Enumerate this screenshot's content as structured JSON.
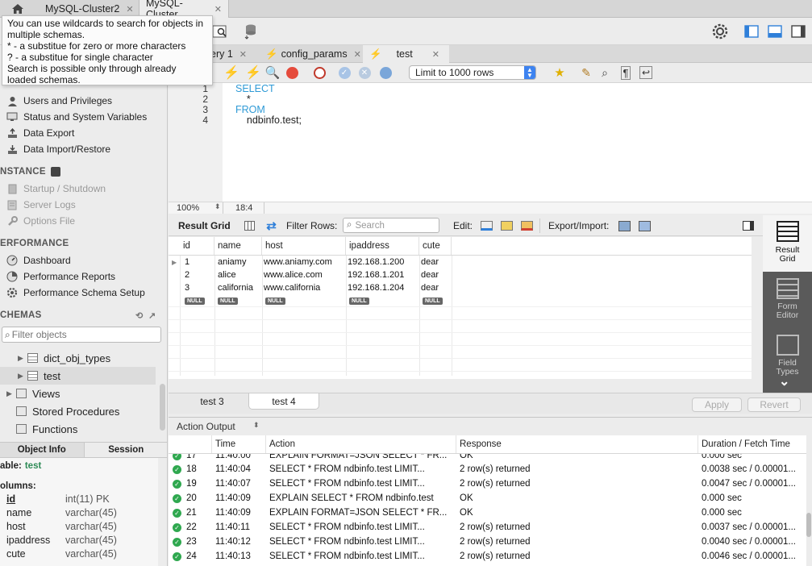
{
  "tabs": {
    "connections": [
      "MySQL-Cluster2",
      "MySQL-Cluster"
    ]
  },
  "tooltip": {
    "lines": [
      "You can use wildcards to search for objects in",
      "multiple schemas.",
      "* - a substitue for zero or more characters",
      "? - a substitue for single character",
      "Search is possible only through already",
      "loaded schemas."
    ]
  },
  "sidebar": {
    "management_items": [
      "Users and Privileges",
      "Status and System Variables",
      "Data Export",
      "Data Import/Restore"
    ],
    "instance_header": "NSTANCE",
    "instance_items": [
      "Startup / Shutdown",
      "Server Logs",
      "Options File"
    ],
    "performance_header": "ERFORMANCE",
    "performance_items": [
      "Dashboard",
      "Performance Reports",
      "Performance Schema Setup"
    ],
    "schemas_header": "CHEMAS",
    "filter_placeholder": "Filter objects",
    "tree": [
      "dict_obj_types",
      "test",
      "Views",
      "Stored Procedures",
      "Functions"
    ],
    "info_tabs": [
      "Object Info",
      "Session"
    ],
    "info": {
      "table_label": "able:",
      "table_name": "test",
      "columns_label": "olumns:",
      "columns": [
        {
          "name": "id",
          "type": "int(11) PK"
        },
        {
          "name": "name",
          "type": "varchar(45)"
        },
        {
          "name": "host",
          "type": "varchar(45)"
        },
        {
          "name": "ipaddress",
          "type": "varchar(45)"
        },
        {
          "name": "cute",
          "type": "varchar(45)"
        }
      ]
    }
  },
  "editor": {
    "tabs": [
      "ery 1",
      "config_params",
      "test"
    ],
    "limit": "Limit to 1000 rows",
    "lines": [
      "SELECT",
      "    *",
      "FROM",
      "    ndbinfo.test;"
    ],
    "line_numbers": [
      "1",
      "2",
      "3",
      "4"
    ],
    "zoom": "100%",
    "position": "18:4"
  },
  "result": {
    "grid_label": "Result Grid",
    "filter_label": "Filter Rows:",
    "search_placeholder": "Search",
    "edit_label": "Edit:",
    "export_label": "Export/Import:",
    "columns": [
      "id",
      "name",
      "host",
      "ipaddress",
      "cute"
    ],
    "rows": [
      [
        "1",
        "aniamy",
        "www.aniamy.com",
        "192.168.1.200",
        "dear"
      ],
      [
        "2",
        "alice",
        "www.alice.com",
        "192.168.1.201",
        "dear"
      ],
      [
        "3",
        "california",
        "www.california",
        "192.168.1.204",
        "dear"
      ]
    ],
    "null_label": "NULL",
    "side_buttons": [
      "Result Grid",
      "Form Editor",
      "Field Types"
    ],
    "tabs": [
      "test 3",
      "test 4"
    ],
    "apply": "Apply",
    "revert": "Revert"
  },
  "output": {
    "title": "Action Output",
    "columns": [
      "Time",
      "Action",
      "Response",
      "Duration / Fetch Time"
    ],
    "rows": [
      {
        "n": "17",
        "time": "11:40:00",
        "action": "EXPLAIN FORMAT=JSON SELECT     * FR...",
        "response": "OK",
        "duration": "0.000 sec"
      },
      {
        "n": "18",
        "time": "11:40:04",
        "action": "SELECT      * FROM      ndbinfo.test LIMIT...",
        "response": "2 row(s) returned",
        "duration": "0.0038 sec / 0.00001..."
      },
      {
        "n": "19",
        "time": "11:40:07",
        "action": "SELECT      * FROM      ndbinfo.test LIMIT...",
        "response": "2 row(s) returned",
        "duration": "0.0047 sec / 0.00001..."
      },
      {
        "n": "20",
        "time": "11:40:09",
        "action": "EXPLAIN SELECT      * FROM      ndbinfo.test",
        "response": "OK",
        "duration": "0.000 sec"
      },
      {
        "n": "21",
        "time": "11:40:09",
        "action": "EXPLAIN FORMAT=JSON SELECT     * FR...",
        "response": "OK",
        "duration": "0.000 sec"
      },
      {
        "n": "22",
        "time": "11:40:11",
        "action": "SELECT      * FROM      ndbinfo.test LIMIT...",
        "response": "2 row(s) returned",
        "duration": "0.0037 sec / 0.00001..."
      },
      {
        "n": "23",
        "time": "11:40:12",
        "action": "SELECT      * FROM      ndbinfo.test LIMIT...",
        "response": "2 row(s) returned",
        "duration": "0.0040 sec / 0.00001..."
      },
      {
        "n": "24",
        "time": "11:40:13",
        "action": "SELECT      * FROM      ndbinfo.test LIMIT...",
        "response": "2 row(s) returned",
        "duration": "0.0046 sec / 0.00001..."
      }
    ]
  }
}
